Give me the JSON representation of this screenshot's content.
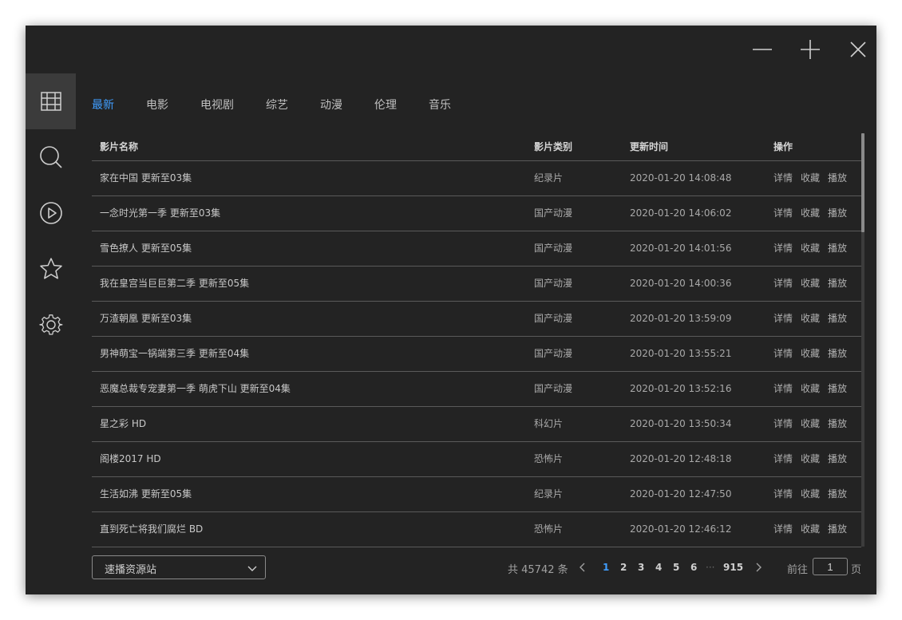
{
  "tabs": [
    "最新",
    "电影",
    "电视剧",
    "综艺",
    "动漫",
    "伦理",
    "音乐"
  ],
  "active_tab": 0,
  "sidebar": {
    "items": [
      {
        "icon": "film-grid-icon",
        "active": true
      },
      {
        "icon": "search-icon",
        "active": false
      },
      {
        "icon": "play-circle-icon",
        "active": false
      },
      {
        "icon": "star-icon",
        "active": false
      },
      {
        "icon": "gear-icon",
        "active": false
      }
    ]
  },
  "table": {
    "headers": {
      "name": "影片名称",
      "type": "影片类别",
      "time": "更新时间",
      "ops": "操作"
    },
    "rows": [
      {
        "name": "家在中国 更新至03集",
        "type": "纪录片",
        "time": "2020-01-20 14:08:48"
      },
      {
        "name": "一念时光第一季 更新至03集",
        "type": "国产动漫",
        "time": "2020-01-20 14:06:02"
      },
      {
        "name": "雪色撩人 更新至05集",
        "type": "国产动漫",
        "time": "2020-01-20 14:01:56"
      },
      {
        "name": "我在皇宫当巨巨第二季 更新至05集",
        "type": "国产动漫",
        "time": "2020-01-20 14:00:36"
      },
      {
        "name": "万渣朝凰 更新至03集",
        "type": "国产动漫",
        "time": "2020-01-20 13:59:09"
      },
      {
        "name": "男神萌宝一锅端第三季 更新至04集",
        "type": "国产动漫",
        "time": "2020-01-20 13:55:21"
      },
      {
        "name": "恶魔总裁专宠妻第一季 萌虎下山 更新至04集",
        "type": "国产动漫",
        "time": "2020-01-20 13:52:16"
      },
      {
        "name": "星之彩 HD",
        "type": "科幻片",
        "time": "2020-01-20 13:50:34"
      },
      {
        "name": "阁楼2017 HD",
        "type": "恐怖片",
        "time": "2020-01-20 12:48:18"
      },
      {
        "name": "生活如沸 更新至05集",
        "type": "纪录片",
        "time": "2020-01-20 12:47:50"
      },
      {
        "name": "直到死亡将我们腐烂 BD",
        "type": "恐怖片",
        "time": "2020-01-20 12:46:12"
      }
    ],
    "ops": {
      "detail": "详情",
      "favorite": "收藏",
      "play": "播放"
    }
  },
  "footer": {
    "source": "速播资源站",
    "total": "共 45742 条",
    "pages": [
      "1",
      "2",
      "3",
      "4",
      "5",
      "6"
    ],
    "current_page": "1",
    "ellipsis": "···",
    "last_page": "915",
    "goto_label": "前往",
    "goto_value": "1",
    "goto_suffix": "页"
  },
  "colors": {
    "accent": "#409eff",
    "background": "#232323",
    "sidebar_active": "#3b3b3b"
  }
}
